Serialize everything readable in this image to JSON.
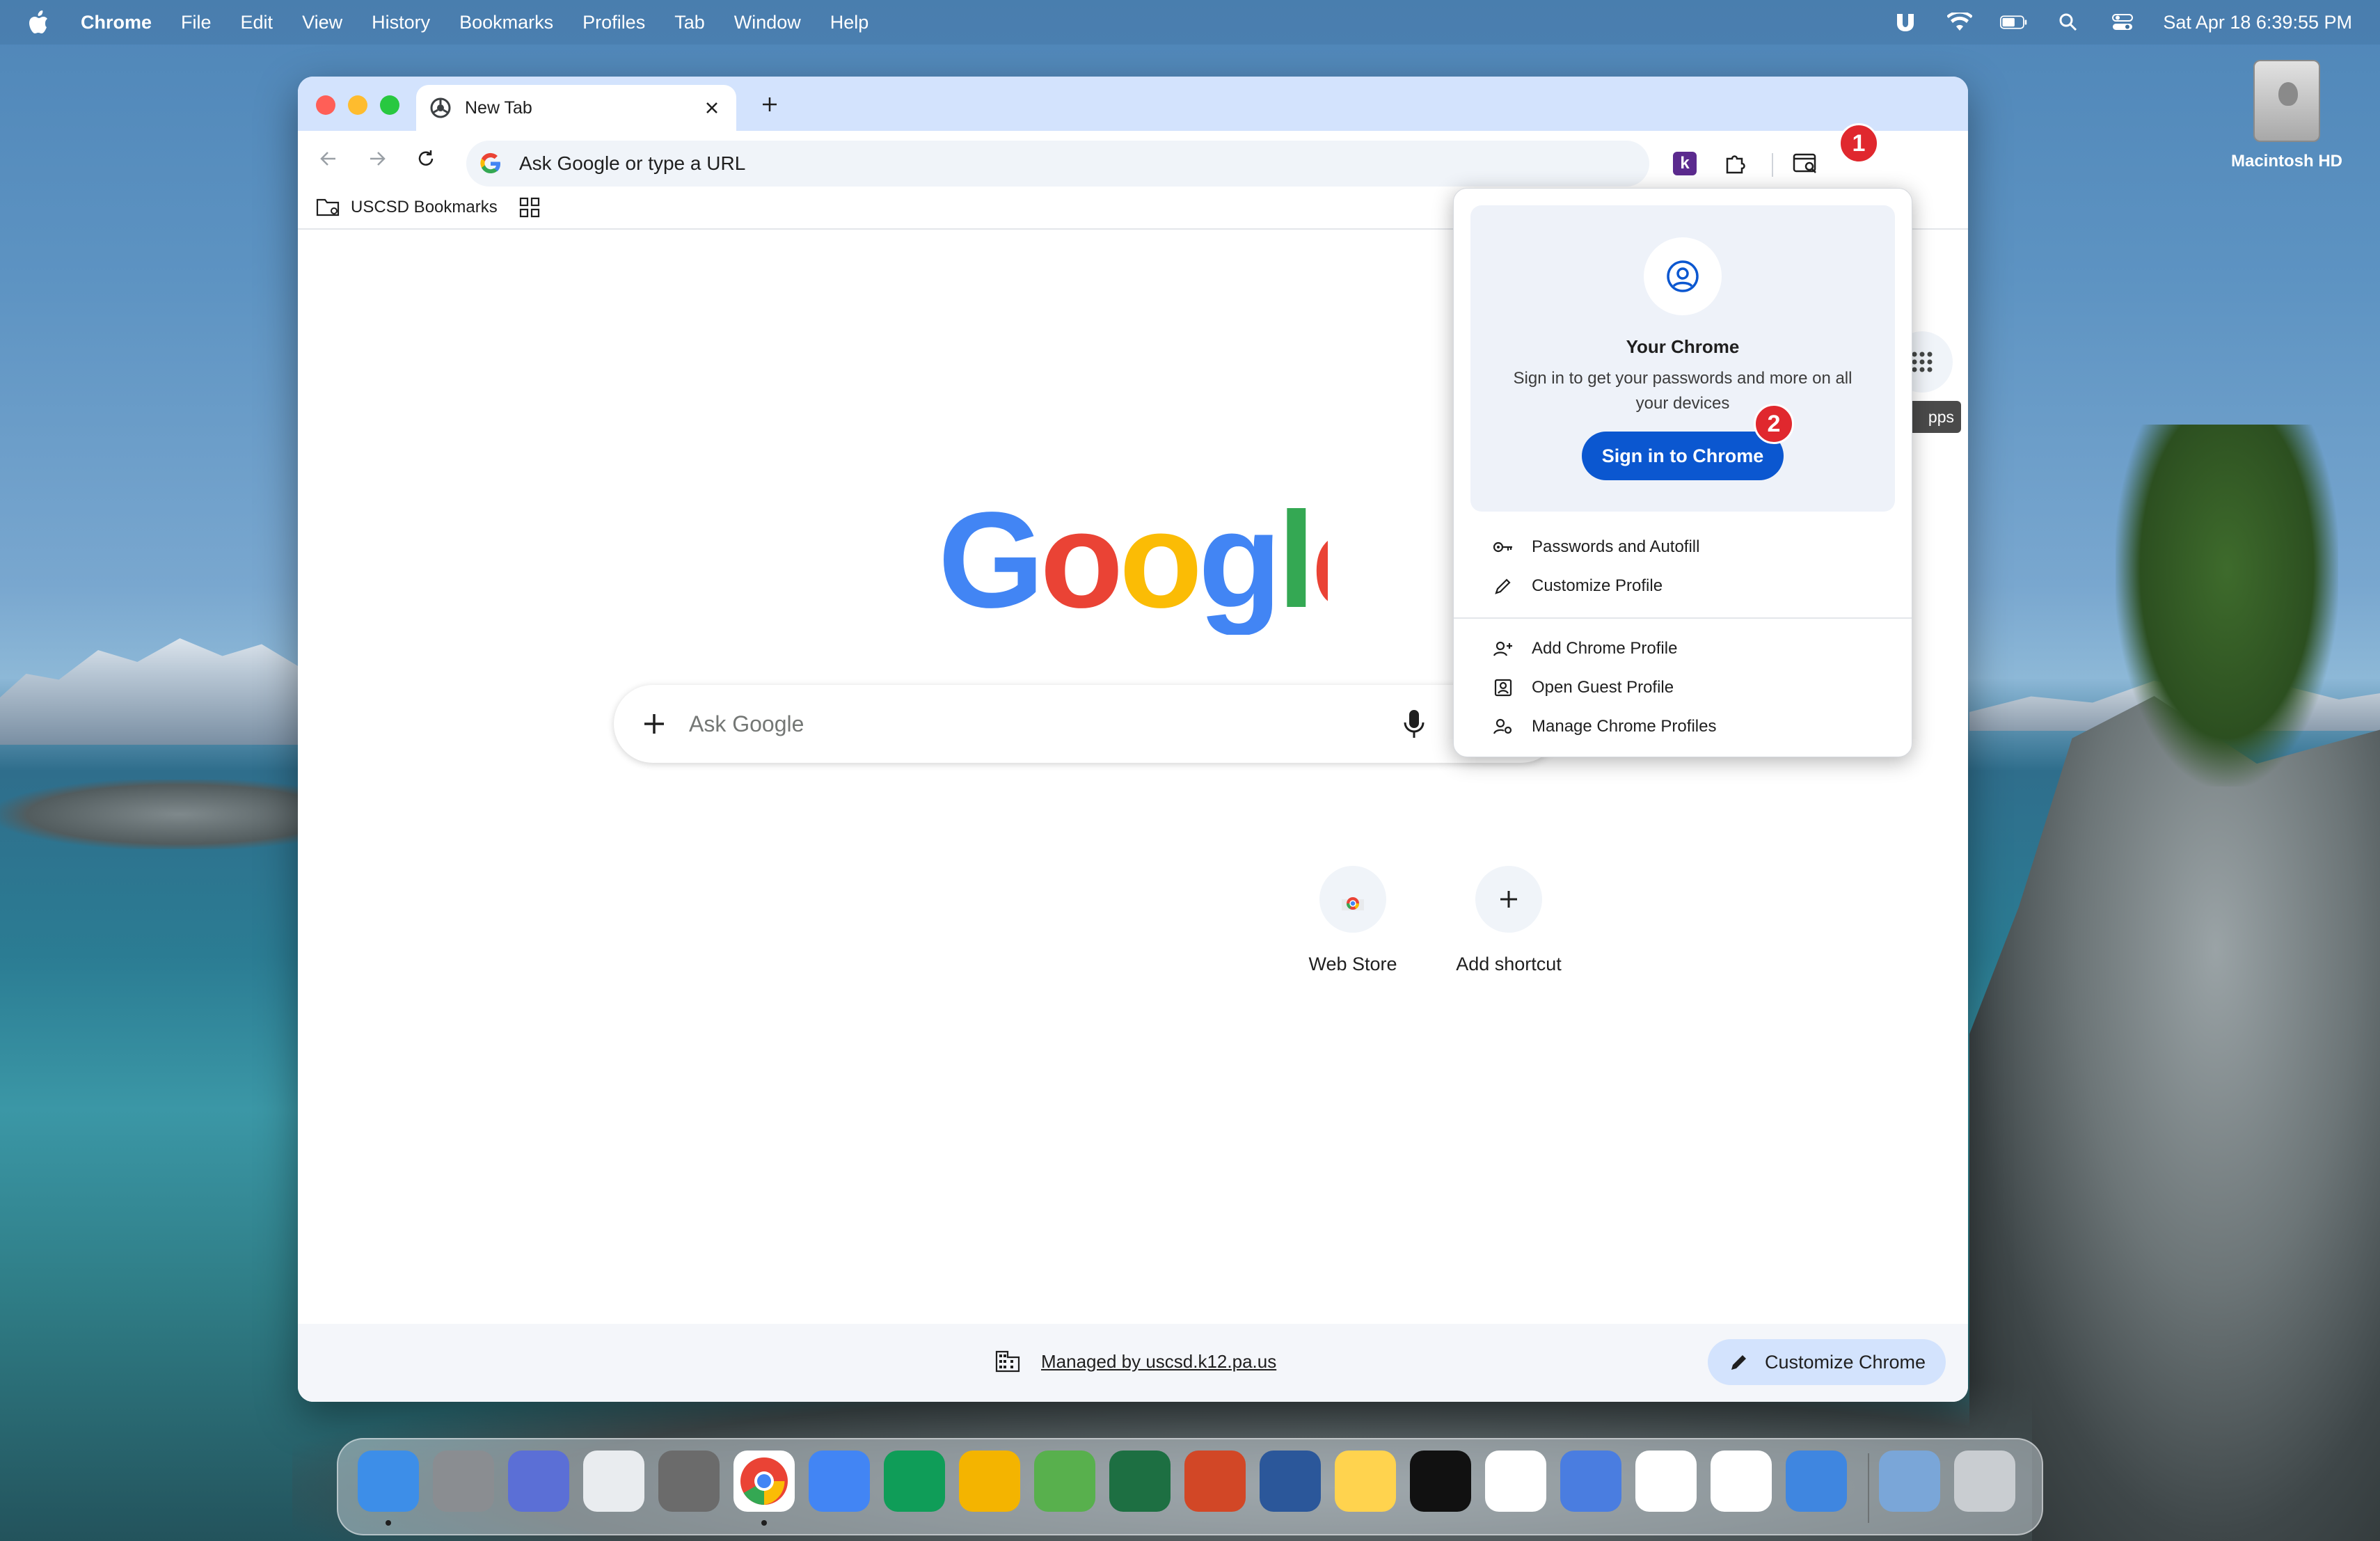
{
  "menubar": {
    "app_name": "Chrome",
    "items": [
      "File",
      "Edit",
      "View",
      "History",
      "Bookmarks",
      "Profiles",
      "Tab",
      "Window",
      "Help"
    ],
    "datetime": "Sat Apr 18  6:39:55 PM"
  },
  "desktop": {
    "drive_label": "Macintosh HD"
  },
  "browser": {
    "tab_title": "New Tab",
    "omnibox_placeholder": "Ask Google or type a URL",
    "extension_letter": "k",
    "bookmarks": {
      "folder_label": "USCSD Bookmarks"
    }
  },
  "newtab": {
    "search_placeholder": "Ask Google",
    "logo_text": [
      "G",
      "o",
      "o",
      "g",
      "l",
      "e"
    ],
    "logo_colors": [
      "#4285f4",
      "#ea4335",
      "#fbbc05",
      "#4285f4",
      "#34a853",
      "#ea4335"
    ],
    "shortcuts": [
      {
        "label": "Web Store"
      },
      {
        "label": "Add shortcut"
      }
    ],
    "apps_tooltip": "pps",
    "managed_by": "Managed by uscsd.k12.pa.us",
    "customize_label": "Customize Chrome"
  },
  "profile_menu": {
    "title": "Your Chrome",
    "subtitle": "Sign in to get your passwords and more on all your devices",
    "signin_label": "Sign in to Chrome",
    "items_top": [
      "Passwords and Autofill",
      "Customize Profile"
    ],
    "items_bottom": [
      "Add Chrome Profile",
      "Open Guest Profile",
      "Manage Chrome Profiles"
    ]
  },
  "annotations": {
    "badge_1": "1",
    "badge_2": "2"
  },
  "dock": {
    "apps": [
      {
        "icon": "finder-icon",
        "color": "#3d8ee8"
      },
      {
        "icon": "system-settings-icon",
        "color": "#8a8d91"
      },
      {
        "icon": "simulator-icon",
        "color": "#5b6fd6"
      },
      {
        "icon": "launchpad-icon",
        "color": "#e9ecef"
      },
      {
        "icon": "calculator-icon",
        "color": "#6b6b6b"
      },
      {
        "icon": "chrome-icon",
        "color": "#ffffff"
      },
      {
        "icon": "google-docs-icon",
        "color": "#4285f4"
      },
      {
        "icon": "google-sheets-icon",
        "color": "#0f9d58"
      },
      {
        "icon": "google-slides-icon",
        "color": "#f4b400"
      },
      {
        "icon": "maps-icon",
        "color": "#58b04d"
      },
      {
        "icon": "excel-icon",
        "color": "#1d6f42"
      },
      {
        "icon": "powerpoint-icon",
        "color": "#d24726"
      },
      {
        "icon": "word-icon",
        "color": "#2b579a"
      },
      {
        "icon": "notes-icon",
        "color": "#ffd34e"
      },
      {
        "icon": "apple-tv-icon",
        "color": "#111111"
      },
      {
        "icon": "photos-icon",
        "color": "#ffffff"
      },
      {
        "icon": "self-service-icon",
        "color": "#4a7de0"
      },
      {
        "icon": "reminders-icon",
        "color": "#ffffff"
      },
      {
        "icon": "slack-icon",
        "color": "#ffffff"
      },
      {
        "icon": "weather-icon",
        "color": "#3f86e0"
      },
      {
        "icon": "downloads-folder-icon",
        "color": "#7aa6d8"
      },
      {
        "icon": "trash-icon",
        "color": "#c9cdd1"
      }
    ]
  }
}
